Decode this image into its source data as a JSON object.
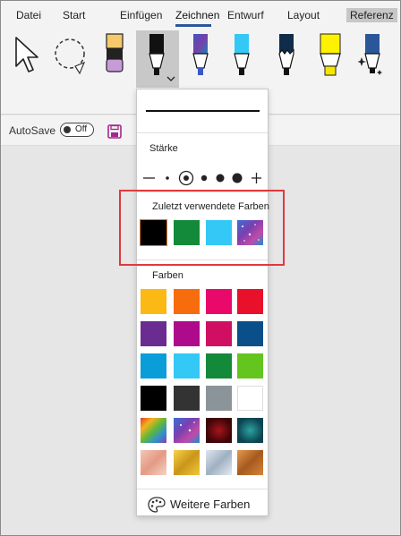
{
  "tabs": [
    {
      "label": "Datei"
    },
    {
      "label": "Start"
    },
    {
      "label": "Einfügen"
    },
    {
      "label": "Zeichnen"
    },
    {
      "label": "Entwurf"
    },
    {
      "label": "Layout"
    },
    {
      "label": "Referenz"
    }
  ],
  "tools": [
    "select-arrow",
    "lasso-select",
    "eraser",
    "pen-black",
    "pen-galaxy",
    "pen-cyan",
    "pen-black-2",
    "pencil-navy",
    "highlighter-yellow",
    "action-pen"
  ],
  "autosave": {
    "label": "AutoSave",
    "toggle": "Off"
  },
  "panel": {
    "thickness_label": "Stärke",
    "recent_label": "Zuletzt verwendete Farben",
    "colors_label": "Farben",
    "more_colors": "Weitere Farben",
    "recent_colors": [
      "#000000",
      "#138a3a",
      "#33c8f5",
      "galaxy"
    ],
    "colors": [
      [
        "#fcb814",
        "#f76c0c",
        "#e8096b",
        "#e8102a"
      ],
      [
        "#6a2c91",
        "#ae0a8c",
        "#d10f62",
        "#0b4f8a"
      ],
      [
        "#0a9dd8",
        "#33c8f5",
        "#138a3a",
        "#64c51e"
      ],
      [
        "#000000",
        "#333333",
        "#8b9599",
        "#ffffff"
      ],
      [
        "rainbow",
        "galaxy",
        "ruby",
        "ocean"
      ],
      [
        "rose-gold",
        "gold",
        "silver",
        "bronze"
      ]
    ]
  },
  "accent": "#2b579a",
  "highlight_color": "#e0393e"
}
